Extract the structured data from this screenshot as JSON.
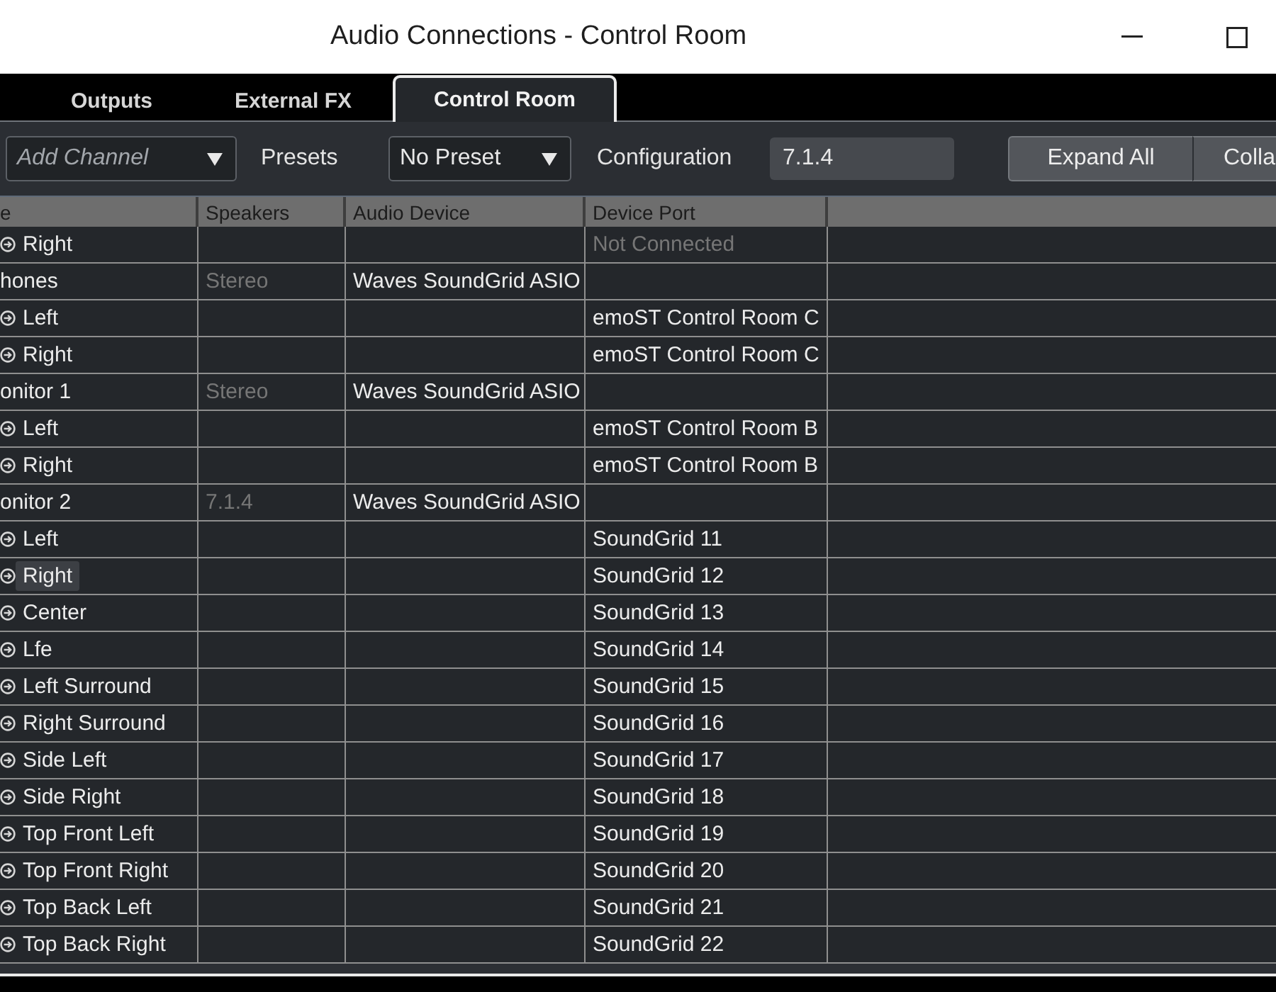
{
  "window": {
    "title": "Audio Connections - Control Room"
  },
  "tabs": [
    {
      "label": "Outputs",
      "selected": false
    },
    {
      "label": "External FX",
      "selected": false
    },
    {
      "label": "Control Room",
      "selected": true
    }
  ],
  "toolbar": {
    "add_channel": {
      "placeholder": "Add Channel"
    },
    "presets_label": "Presets",
    "preset": {
      "value": "No Preset"
    },
    "configuration_label": "Configuration",
    "configuration": {
      "value": "7.1.4"
    },
    "buttons": [
      "Expand All",
      "Colla"
    ]
  },
  "table": {
    "columns": [
      "e",
      "Speakers",
      "Audio Device",
      "Device Port"
    ],
    "rows": [
      {
        "kind": "channel",
        "name": "Right",
        "device_port": "Not Connected",
        "connected": false,
        "selected": false
      },
      {
        "kind": "bus",
        "name": "hones",
        "speakers": "Stereo",
        "audio_device": "Waves SoundGrid ASIO",
        "selected": false
      },
      {
        "kind": "channel",
        "name": "Left",
        "device_port": "emoST Control Room C",
        "connected": true,
        "selected": false
      },
      {
        "kind": "channel",
        "name": "Right",
        "device_port": "emoST Control Room C",
        "connected": true,
        "selected": false
      },
      {
        "kind": "bus",
        "name": "onitor 1",
        "speakers": "Stereo",
        "audio_device": "Waves SoundGrid ASIO",
        "selected": false
      },
      {
        "kind": "channel",
        "name": "Left",
        "device_port": "emoST Control Room B",
        "connected": true,
        "selected": false
      },
      {
        "kind": "channel",
        "name": "Right",
        "device_port": "emoST Control Room B",
        "connected": true,
        "selected": false
      },
      {
        "kind": "bus",
        "name": "onitor 2",
        "speakers": "7.1.4",
        "audio_device": "Waves SoundGrid ASIO",
        "selected": false
      },
      {
        "kind": "channel",
        "name": "Left",
        "device_port": "SoundGrid 11",
        "connected": true,
        "selected": false
      },
      {
        "kind": "channel",
        "name": "Right",
        "device_port": "SoundGrid 12",
        "connected": true,
        "selected": true
      },
      {
        "kind": "channel",
        "name": "Center",
        "device_port": "SoundGrid 13",
        "connected": true,
        "selected": false
      },
      {
        "kind": "channel",
        "name": "Lfe",
        "device_port": "SoundGrid 14",
        "connected": true,
        "selected": false
      },
      {
        "kind": "channel",
        "name": "Left Surround",
        "device_port": "SoundGrid 15",
        "connected": true,
        "selected": false
      },
      {
        "kind": "channel",
        "name": "Right Surround",
        "device_port": "SoundGrid 16",
        "connected": true,
        "selected": false
      },
      {
        "kind": "channel",
        "name": "Side Left",
        "device_port": "SoundGrid 17",
        "connected": true,
        "selected": false
      },
      {
        "kind": "channel",
        "name": "Side Right",
        "device_port": "SoundGrid 18",
        "connected": true,
        "selected": false
      },
      {
        "kind": "channel",
        "name": "Top Front Left",
        "device_port": "SoundGrid 19",
        "connected": true,
        "selected": false
      },
      {
        "kind": "channel",
        "name": "Top Front Right",
        "device_port": "SoundGrid 20",
        "connected": true,
        "selected": false
      },
      {
        "kind": "channel",
        "name": "Top Back Left",
        "device_port": "SoundGrid 21",
        "connected": true,
        "selected": false
      },
      {
        "kind": "channel",
        "name": "Top Back Right",
        "device_port": "SoundGrid 22",
        "connected": true,
        "selected": false
      }
    ]
  }
}
